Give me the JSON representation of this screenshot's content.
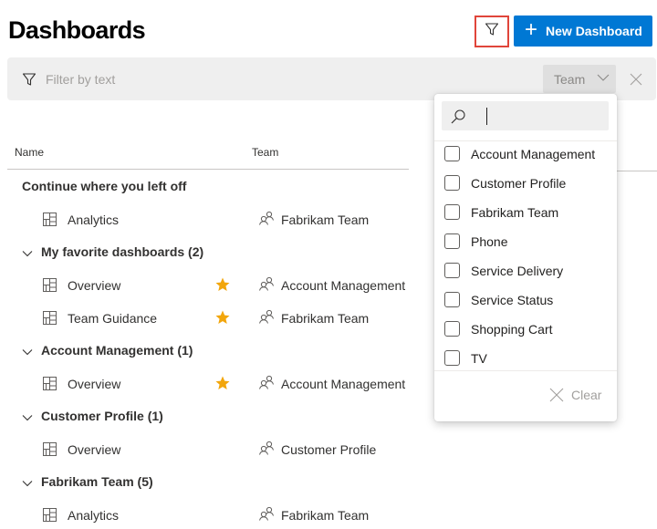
{
  "header": {
    "title": "Dashboards",
    "filter_toggle_icon": "filter-icon",
    "new_button": {
      "icon": "plus-icon",
      "label": "New Dashboard"
    }
  },
  "filter_bar": {
    "icon": "filter-icon",
    "placeholder": "Filter by text",
    "team_dropdown": {
      "label": "Team",
      "icon": "chevron-down-icon"
    },
    "clear_icon": "close-icon"
  },
  "columns": {
    "name": "Name",
    "team": "Team"
  },
  "groups": [
    {
      "title": "Continue where you left off",
      "collapsible": false,
      "items": [
        {
          "name": "Analytics",
          "favorite": false,
          "team": "Fabrikam Team"
        }
      ]
    },
    {
      "title": "My favorite dashboards (2)",
      "collapsible": true,
      "items": [
        {
          "name": "Overview",
          "favorite": true,
          "team": "Account Management"
        },
        {
          "name": "Team Guidance",
          "favorite": true,
          "team": "Fabrikam Team"
        }
      ]
    },
    {
      "title": "Account Management (1)",
      "collapsible": true,
      "items": [
        {
          "name": "Overview",
          "favorite": true,
          "team": "Account Management"
        }
      ]
    },
    {
      "title": "Customer Profile (1)",
      "collapsible": true,
      "items": [
        {
          "name": "Overview",
          "favorite": false,
          "team": "Customer Profile"
        }
      ]
    },
    {
      "title": "Fabrikam Team (5)",
      "collapsible": true,
      "items": [
        {
          "name": "Analytics",
          "favorite": false,
          "team": "Fabrikam Team"
        }
      ]
    }
  ],
  "team_dropdown_panel": {
    "search_icon": "search-icon",
    "search_value": "",
    "options": [
      {
        "label": "Account Management",
        "checked": false
      },
      {
        "label": "Customer Profile",
        "checked": false
      },
      {
        "label": "Fabrikam Team",
        "checked": false
      },
      {
        "label": "Phone",
        "checked": false
      },
      {
        "label": "Service Delivery",
        "checked": false
      },
      {
        "label": "Service Status",
        "checked": false
      },
      {
        "label": "Shopping Cart",
        "checked": false
      },
      {
        "label": "TV",
        "checked": false
      }
    ],
    "clear_label": "Clear"
  },
  "colors": {
    "accent": "#0078d4",
    "highlight_border": "#e0453a",
    "star": "#f2a60c",
    "filter_bar_bg": "#efefef"
  }
}
